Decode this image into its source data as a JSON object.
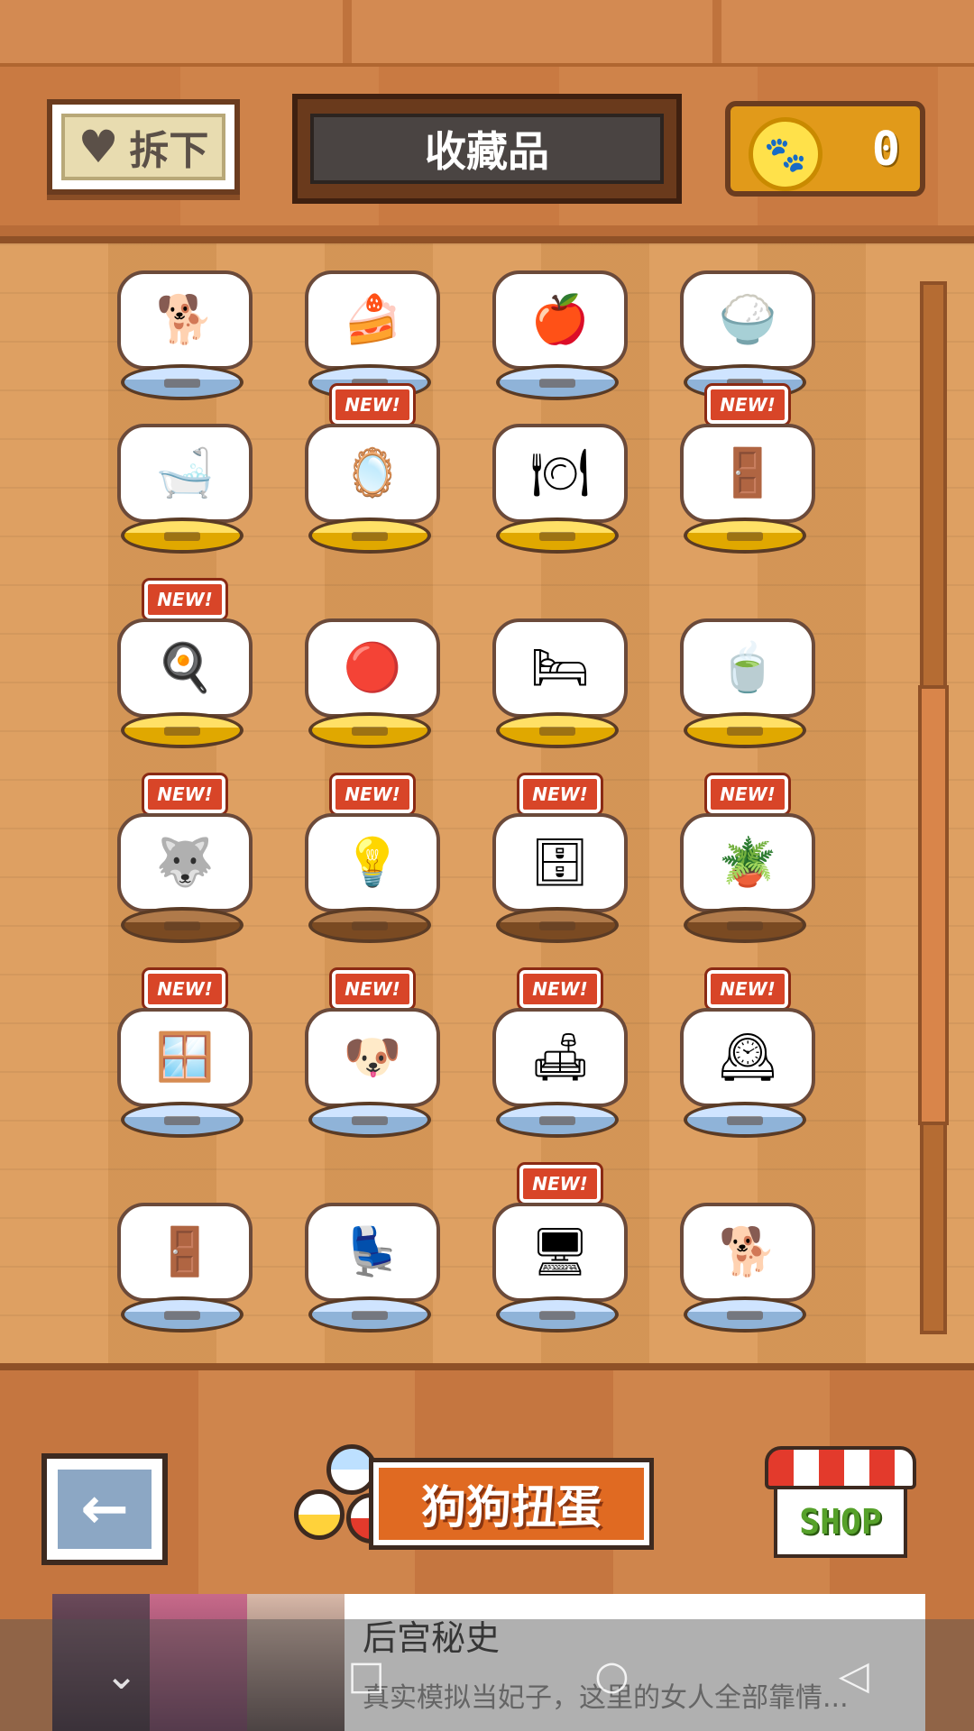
{
  "header": {
    "remove_label": "拆下",
    "title": "收藏品",
    "coin_value": "0"
  },
  "badge_text": "NEW!",
  "items": [
    {
      "icon": "boy-and-dog",
      "glyph": "🐕",
      "new": false,
      "base": "blue"
    },
    {
      "icon": "cake-table",
      "glyph": "🍰",
      "new": false,
      "base": "blue"
    },
    {
      "icon": "apple-dog",
      "glyph": "🍎",
      "new": false,
      "base": "blue"
    },
    {
      "icon": "dog-dishes",
      "glyph": "🍚",
      "new": false,
      "base": "blue"
    },
    {
      "icon": "bathtub-dog",
      "glyph": "🛁",
      "new": false,
      "base": "gold"
    },
    {
      "icon": "mirror-dog",
      "glyph": "🪞",
      "new": true,
      "base": "gold"
    },
    {
      "icon": "dining-dog",
      "glyph": "🍽",
      "new": false,
      "base": "gold"
    },
    {
      "icon": "door-dog",
      "glyph": "🚪",
      "new": true,
      "base": "gold"
    },
    {
      "icon": "kitchen-dog",
      "glyph": "🍳",
      "new": true,
      "base": "gold"
    },
    {
      "icon": "gacha-ball-dog",
      "glyph": "🔴",
      "new": false,
      "base": "gold"
    },
    {
      "icon": "bed-dog",
      "glyph": "🛏",
      "new": false,
      "base": "gold"
    },
    {
      "icon": "tea-set-dog",
      "glyph": "🍵",
      "new": false,
      "base": "gold"
    },
    {
      "icon": "husky-sitting",
      "glyph": "🐺",
      "new": true,
      "base": "wood"
    },
    {
      "icon": "lamp-husky",
      "glyph": "💡",
      "new": true,
      "base": "wood"
    },
    {
      "icon": "wardrobe",
      "glyph": "🗄",
      "new": true,
      "base": "wood"
    },
    {
      "icon": "plant-table",
      "glyph": "🪴",
      "new": true,
      "base": "wood"
    },
    {
      "icon": "window-husky",
      "glyph": "🪟",
      "new": true,
      "base": "blue"
    },
    {
      "icon": "two-dogs",
      "glyph": "🐶",
      "new": true,
      "base": "blue"
    },
    {
      "icon": "sofa-dogs",
      "glyph": "🛋",
      "new": true,
      "base": "blue"
    },
    {
      "icon": "round-window-dogs",
      "glyph": "🕰",
      "new": true,
      "base": "blue"
    },
    {
      "icon": "door-husky",
      "glyph": "🚪",
      "new": false,
      "base": "blue"
    },
    {
      "icon": "armchair-husky",
      "glyph": "💺",
      "new": false,
      "base": "blue"
    },
    {
      "icon": "tv-desk",
      "glyph": "🖥",
      "new": true,
      "base": "blue"
    },
    {
      "icon": "cushion-husky",
      "glyph": "🐕",
      "new": false,
      "base": "blue"
    }
  ],
  "footer": {
    "back_icon": "←",
    "gacha_label": "狗狗扭蛋",
    "shop_label": "SHOP"
  },
  "ad": {
    "title": "后宫秘史",
    "description": "真实模拟当妃子，这里的女人全部靠情..."
  },
  "nav": {
    "down": "⌄",
    "home": "○",
    "recents": "□",
    "back": "◁"
  },
  "colors": {
    "accent_orange": "#e06a22",
    "badge_red": "#d84528",
    "coin_gold": "#e19a1a"
  }
}
